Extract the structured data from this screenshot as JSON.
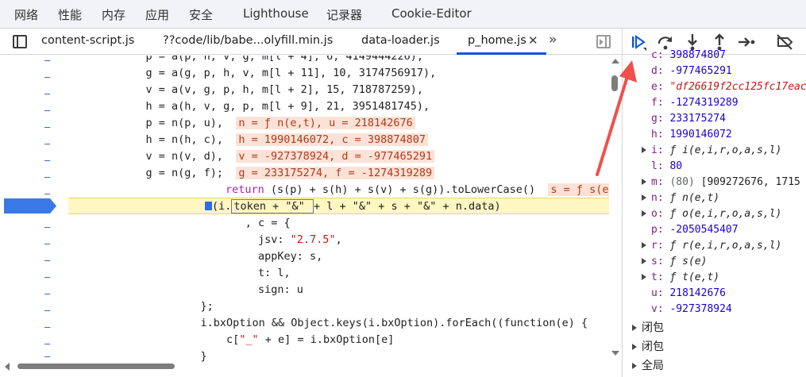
{
  "panel_tabs": [
    "网络",
    "性能",
    "内存",
    "应用",
    "安全",
    "Lighthouse",
    "记录器",
    "Cookie-Editor"
  ],
  "file_tabs": [
    {
      "label": "content-script.js",
      "active": false
    },
    {
      "label": "??code/lib/babe...olyfill.min.js",
      "active": false
    },
    {
      "label": "data-loader.js",
      "active": false
    },
    {
      "label": "p_home.js",
      "active": true
    }
  ],
  "gutter_marker": "–",
  "code": {
    "l1": {
      "pre": "            p = a(p, h, v, g, m[l + 4], 6, 4149444226),"
    },
    "l2": {
      "pre": "            g = a(g, p, h, v, m[l + 11], 10, 3174756917),"
    },
    "l3": {
      "pre": "            v = a(v, g, p, h, m[l + 2], 15, 718787259),"
    },
    "l4": {
      "pre": "            h = a(h, v, g, p, m[l + 9], 21, 3951481745),"
    },
    "l5": {
      "code": "            p = n(p, u),  ",
      "val": "n = ƒ n(e,t), u = 218142676"
    },
    "l6": {
      "code": "            h = n(h, c),  ",
      "val": "h = 1990146072, c = 398874807"
    },
    "l7": {
      "code": "            v = n(v, d),  ",
      "val": "v = -927378924, d = -977465291"
    },
    "l8": {
      "code": "            g = n(g, f);  ",
      "val": "g = 233175274, f = -1274319289"
    },
    "l9": {
      "kw": "return",
      "code": " (s(p) + s(h) + s(v) + s(g)).toLowerCase()  ",
      "val": "s = ƒ s(e)"
    },
    "l10": {
      "open": "(i.",
      "token": "token + \"&\" ",
      "rest": "+ l + \"&\" + s + \"&\" + n.data)"
    },
    "l11": "      , c = {",
    "l12": {
      "key": "        jsv: ",
      "str": "\"2.7.5\"",
      "end": ","
    },
    "l13": "        appKey: s,",
    "l14": "        t: l,",
    "l15": "        sign: u",
    "l16": "    };",
    "l17": "    i.bxOption && Object.keys(i.bxOption).forEach((function(e) {",
    "l18": {
      "pre": "        c[",
      "str": "\"_\"",
      "post": " + e] = i.bxOption[e]"
    },
    "l19": "    }"
  },
  "scope": {
    "c": {
      "key": "c:",
      "value": "398874807"
    },
    "d": {
      "key": "d:",
      "value": "-977465291"
    },
    "e": {
      "key": "e:",
      "value": "\"df26619f2cc125fc17eac"
    },
    "f": {
      "key": "f:",
      "value": "-1274319289"
    },
    "g": {
      "key": "g:",
      "value": "233175274"
    },
    "h": {
      "key": "h:",
      "value": "1990146072"
    },
    "i": {
      "key": "i:",
      "value": "ƒ i(e,i,r,o,a,s,l)"
    },
    "l": {
      "key": "l:",
      "value": "80"
    },
    "m": {
      "key": "m:",
      "len": "(80)",
      "value": "[909272676, 1715"
    },
    "n": {
      "key": "n:",
      "value": "ƒ n(e,t)"
    },
    "o": {
      "key": "o:",
      "value": "ƒ o(e,i,r,o,a,s,l)"
    },
    "p": {
      "key": "p:",
      "value": "-2050545407"
    },
    "r": {
      "key": "r:",
      "value": "ƒ r(e,i,r,o,a,s,l)"
    },
    "s": {
      "key": "s:",
      "value": "ƒ s(e)"
    },
    "t": {
      "key": "t:",
      "value": "ƒ t(e,t)"
    },
    "u": {
      "key": "u:",
      "value": "218142676"
    },
    "v": {
      "key": "v:",
      "value": "-927378924"
    }
  },
  "sections": [
    "闭包",
    "闭包",
    "全局"
  ],
  "colors": {
    "accent": "#0b57d0",
    "exec_marker": "#3b78e7",
    "highlight": "#fef7c2",
    "arrow": "#f0504a"
  }
}
